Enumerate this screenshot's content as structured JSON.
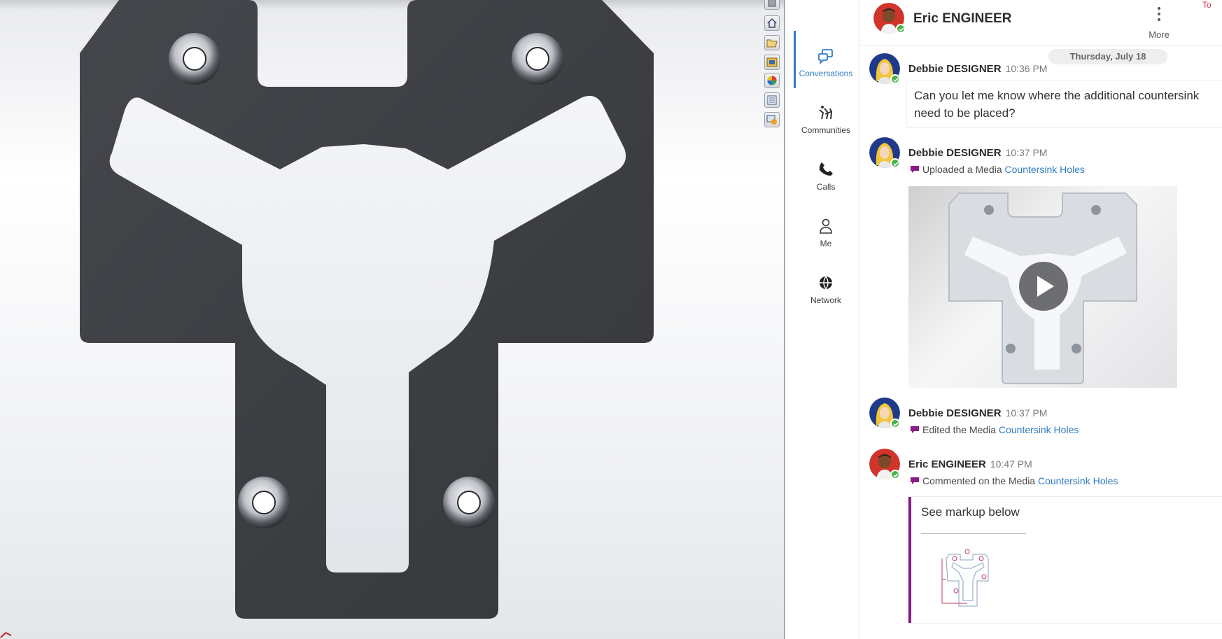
{
  "cad": {
    "taskpane_icons": [
      "resources-icon",
      "home-icon",
      "folder-icon",
      "view-palette-icon",
      "appearances-icon",
      "custom-properties-icon",
      "3dexperience-icon"
    ]
  },
  "nav": {
    "items": [
      {
        "label": "Conversations",
        "icon": "conversations-icon",
        "active": true
      },
      {
        "label": "Communities",
        "icon": "communities-icon",
        "active": false
      },
      {
        "label": "Calls",
        "icon": "phone-icon",
        "active": false
      },
      {
        "label": "Me",
        "icon": "user-icon",
        "active": false
      },
      {
        "label": "Network",
        "icon": "network-icon",
        "active": false
      }
    ]
  },
  "chat": {
    "header": {
      "name": "Eric ENGINEER",
      "more_label": "More",
      "edge_text": "To"
    },
    "date_divider": "Thursday, July 18",
    "messages": [
      {
        "author": "Debbie DESIGNER",
        "time": "10:36 PM",
        "text": "Can you let me know where the additional countersink need to be placed?"
      },
      {
        "author": "Debbie DESIGNER",
        "time": "10:37 PM",
        "activity": "Uploaded a Media",
        "link": "Countersink Holes"
      },
      {
        "author": "Debbie DESIGNER",
        "time": "10:37 PM",
        "activity": "Edited the Media",
        "link": "Countersink Holes"
      },
      {
        "author": "Eric ENGINEER",
        "time": "10:47 PM",
        "activity": "Commented on the Media",
        "link": "Countersink Holes",
        "comment": "See markup below"
      }
    ]
  },
  "colors": {
    "accent": "#2f7cc3",
    "presence": "#4bb24b",
    "comment_bar": "#8a1a86",
    "part": "#3b3d42"
  }
}
